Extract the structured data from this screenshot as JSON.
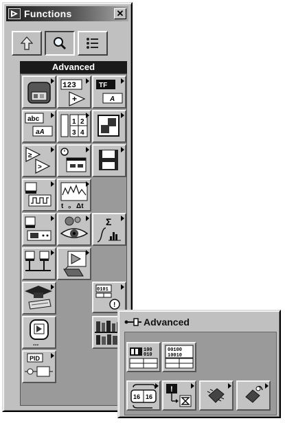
{
  "window": {
    "title": "Functions"
  },
  "toolbar": {
    "up_icon": "up-arrow-icon",
    "search_icon": "magnifier-icon",
    "options_icon": "options-list-icon"
  },
  "palette": {
    "section": "Advanced",
    "text_on_icons": {
      "numeric": "123",
      "boolean": [
        "TF",
        "A"
      ],
      "string": [
        "abc",
        "aA"
      ],
      "array": [
        "1",
        "2",
        "3",
        "4"
      ],
      "timing": [
        "t",
        "Δt"
      ],
      "math": "Σ"
    }
  },
  "subpalette": {
    "title": "Advanced",
    "text_on_icons": {
      "bits_a": "100\n010",
      "bits_b": "00100\n10010",
      "swap": "16 | 16"
    }
  }
}
